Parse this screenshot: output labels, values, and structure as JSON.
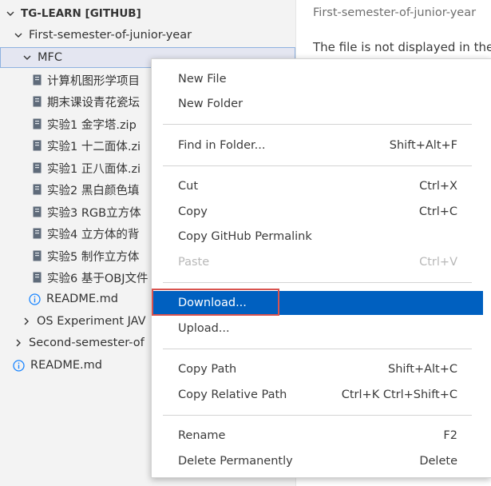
{
  "explorer": {
    "root": "TG-LEARN [GITHUB]",
    "folder_junior1": "First-semester-of-junior-year",
    "folder_mfc": "MFC",
    "files": [
      "计算机图形学项目",
      "期末课设青花瓷坛",
      "实验1 金字塔.zip",
      "实验1 十二面体.zi",
      "实验1 正八面体.zi",
      "实验2 黑白颜色填",
      "实验3 RGB立方体",
      "实验4 立方体的背",
      "实验5 制作立方体",
      "实验6 基于OBJ文件"
    ],
    "readme_mfc": "README.md",
    "folder_os": "OS Experiment JAV",
    "folder_junior2": "Second-semester-of",
    "readme_root": "README.md"
  },
  "editor": {
    "breadcrumb": "First-semester-of-junior-year",
    "message": "The file is not displayed in the"
  },
  "menu": {
    "new_file": "New File",
    "new_folder": "New Folder",
    "find_in_folder": "Find in Folder...",
    "find_in_folder_shortcut": "Shift+Alt+F",
    "cut": "Cut",
    "cut_shortcut": "Ctrl+X",
    "copy": "Copy",
    "copy_shortcut": "Ctrl+C",
    "copy_permalink": "Copy GitHub Permalink",
    "paste": "Paste",
    "paste_shortcut": "Ctrl+V",
    "download": "Download...",
    "upload": "Upload...",
    "copy_path": "Copy Path",
    "copy_path_shortcut": "Shift+Alt+C",
    "copy_relative_path": "Copy Relative Path",
    "copy_relative_path_shortcut": "Ctrl+K Ctrl+Shift+C",
    "rename": "Rename",
    "rename_shortcut": "F2",
    "delete": "Delete Permanently",
    "delete_shortcut": "Delete"
  },
  "colors": {
    "accent": "#0060c0",
    "highlight_border": "#d9534f",
    "sidebar_bg": "#f3f3f3",
    "info_icon": "#1a85ff"
  },
  "icons": {
    "expanded": "chevron-down-icon",
    "collapsed": "chevron-right-icon",
    "file": "file-icon",
    "info": "info-icon"
  }
}
